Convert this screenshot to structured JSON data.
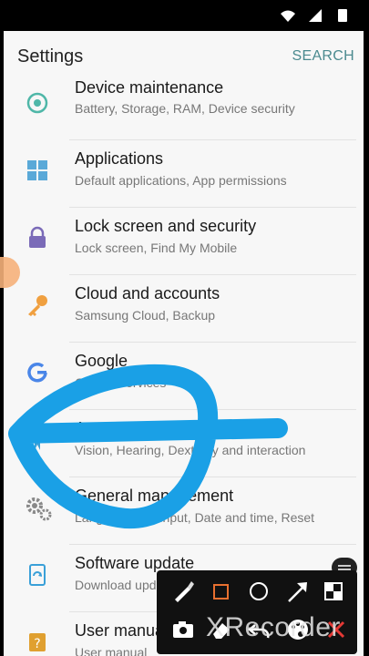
{
  "appbar": {
    "title": "Settings",
    "search_label": "SEARCH"
  },
  "items": [
    {
      "title": "Device maintenance",
      "subtitle": "Battery, Storage, RAM, Device security"
    },
    {
      "title": "Applications",
      "subtitle": "Default applications, App permissions"
    },
    {
      "title": "Lock screen and security",
      "subtitle": "Lock screen, Find My Mobile"
    },
    {
      "title": "Cloud and accounts",
      "subtitle": "Samsung Cloud, Backup"
    },
    {
      "title": "Google",
      "subtitle": "Google services"
    },
    {
      "title": "Accessibility",
      "subtitle": "Vision, Hearing, Dexterity and interaction"
    },
    {
      "title": "General management",
      "subtitle": "Language and input, Date and time, Reset"
    },
    {
      "title": "Software update",
      "subtitle": "Download updates, Scheduled software updates"
    },
    {
      "title": "User manual",
      "subtitle": "User manual"
    }
  ],
  "watermark": "XRecorder",
  "colors": {
    "accent": "#4b8a8f",
    "scribble": "#1aa0e6",
    "icon_blue": "#5aa9d8",
    "icon_purple": "#7b6bb8",
    "icon_orange": "#f0a040"
  }
}
